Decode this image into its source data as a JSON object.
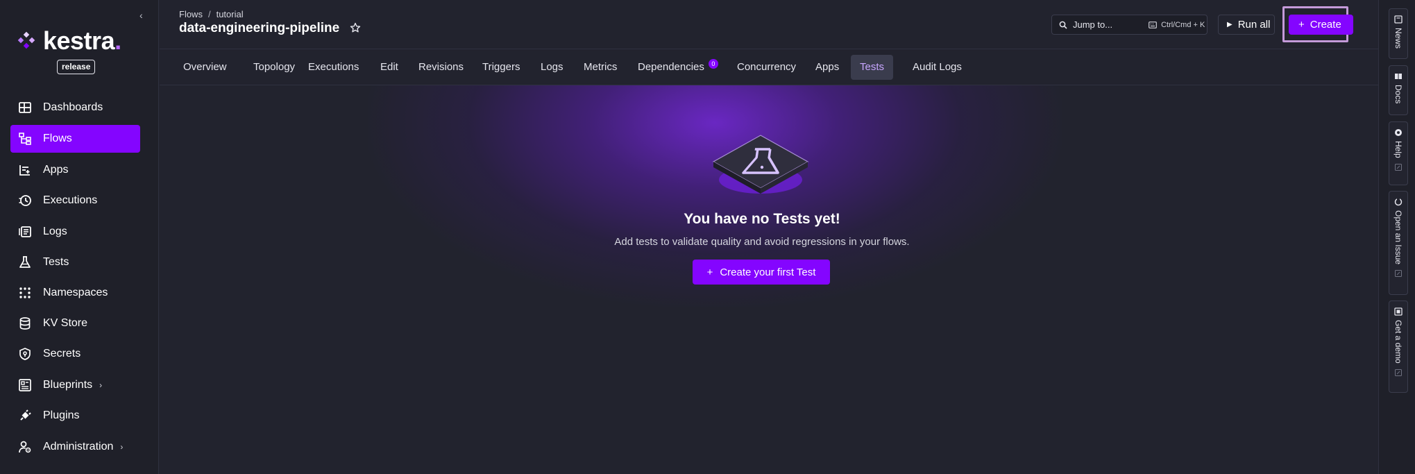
{
  "sidebar": {
    "logo_text": "kestra",
    "logo_dot": ".",
    "badge": "release",
    "items": [
      {
        "label": "Dashboards",
        "icon": "dashboard-icon"
      },
      {
        "label": "Flows",
        "icon": "flows-icon",
        "active": true
      },
      {
        "label": "Apps",
        "icon": "apps-icon"
      },
      {
        "label": "Executions",
        "icon": "executions-icon"
      },
      {
        "label": "Logs",
        "icon": "logs-icon"
      },
      {
        "label": "Tests",
        "icon": "flask-icon"
      },
      {
        "label": "Namespaces",
        "icon": "namespaces-icon"
      },
      {
        "label": "KV Store",
        "icon": "database-icon"
      },
      {
        "label": "Secrets",
        "icon": "shield-icon"
      },
      {
        "label": "Blueprints",
        "icon": "blueprints-icon",
        "chevron": "›"
      },
      {
        "label": "Plugins",
        "icon": "plug-icon"
      },
      {
        "label": "Administration",
        "icon": "admin-icon",
        "chevron": "›"
      }
    ]
  },
  "header": {
    "breadcrumb": [
      "Flows",
      "tutorial"
    ],
    "breadcrumb_sep": "/",
    "title": "data-engineering-pipeline",
    "search_label": "Jump to...",
    "search_shortcut": "Ctrl/Cmd + K",
    "run_all_label": "Run all",
    "create_label": "Create"
  },
  "tabs": [
    {
      "label": "Overview"
    },
    {
      "label": "Topology"
    },
    {
      "label": "Executions"
    },
    {
      "label": "Edit"
    },
    {
      "label": "Revisions"
    },
    {
      "label": "Triggers"
    },
    {
      "label": "Logs"
    },
    {
      "label": "Metrics"
    },
    {
      "label": "Dependencies",
      "badge": "0"
    },
    {
      "label": "Concurrency"
    },
    {
      "label": "Apps"
    },
    {
      "label": "Tests",
      "active": true
    },
    {
      "label": "Audit Logs"
    }
  ],
  "empty_state": {
    "title": "You have no Tests yet!",
    "subtitle": "Add tests to validate quality and avoid regressions in your flows.",
    "button_label": "Create your first Test"
  },
  "rail": [
    {
      "label": "News",
      "icon": "news-icon"
    },
    {
      "label": "Docs",
      "icon": "docs-icon"
    },
    {
      "label": "Help",
      "icon": "help-icon"
    },
    {
      "label": "Open an Issue",
      "icon": "github-icon"
    },
    {
      "label": "Get a demo",
      "icon": "demo-icon"
    }
  ],
  "colors": {
    "accent": "#8405ff",
    "background": "#22232e",
    "sidebar": "#1f2029",
    "active_tab_text": "#c7a6ff"
  }
}
